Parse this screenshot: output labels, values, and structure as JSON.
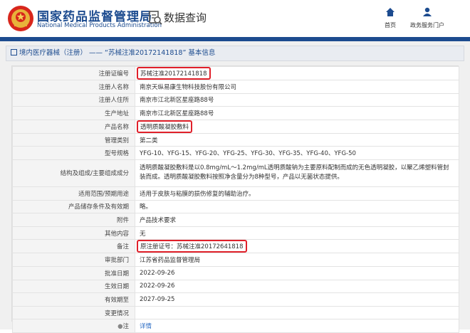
{
  "header": {
    "agency_cn": "国家药品监督管理局",
    "agency_en": "National Medical Products Administration",
    "page_title": "数据查询",
    "nav": [
      {
        "label": "首页",
        "icon": "home-icon"
      },
      {
        "label": "政务服务门户",
        "icon": "user-icon"
      }
    ],
    "brand_color": "#1c4b8f"
  },
  "breadcrumb": "境内医疗器械（注册） —— “苏械注准20172141818” 基本信息",
  "fields": [
    {
      "key": "注册证编号",
      "value": "苏械注准20172141818"
    },
    {
      "key": "注册人名称",
      "value": "南京天纵易康生物科技股份有限公司"
    },
    {
      "key": "注册人住所",
      "value": "南京市江北新区星座路88号"
    },
    {
      "key": "生产地址",
      "value": "南京市江北新区星座路88号"
    },
    {
      "key": "产品名称",
      "value": "透明质酸凝胶敷料"
    },
    {
      "key": "管理类别",
      "value": "第二类"
    },
    {
      "key": "型号规格",
      "value": "YFG-10、YFG-15、YFG-20、YFG-25、YFG-30、YFG-35、YFG-40、YFG-50"
    },
    {
      "key": "结构及组成/主要组成成分",
      "value": "透明质酸凝胶敷料是以0.8mg/mL～1.2mg/mL透明质酸钠为主要原料配制而成的无色透明凝胶，以聚乙烯塑料管封装而成。透明质酸凝胶敷料按照净含量分为8种型号，产品以无菌状态提供。"
    },
    {
      "key": "适用范围/预期用途",
      "value": "适用于皮肤与粘膜的损伤修复的辅助治疗。"
    },
    {
      "key": "产品储存条件及有效期",
      "value": "略。"
    },
    {
      "key": "附件",
      "value": "产品技术要求"
    },
    {
      "key": "其他内容",
      "value": "无"
    },
    {
      "key": "备注",
      "value": "原注册证号：苏械注准20172641818"
    },
    {
      "key": "审批部门",
      "value": "江苏省药品监督管理局"
    },
    {
      "key": "批准日期",
      "value": "2022-09-26"
    },
    {
      "key": "生效日期",
      "value": "2022-09-26"
    },
    {
      "key": "有效期至",
      "value": "2027-09-25"
    },
    {
      "key": "变更情况",
      "value": ""
    },
    {
      "key": "注",
      "value": "详情",
      "icon": "bullet-icon"
    }
  ],
  "highlight_color": "#e0202a"
}
